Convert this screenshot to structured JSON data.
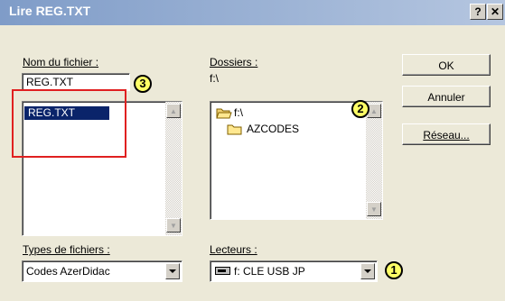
{
  "window": {
    "title": "Lire REG.TXT",
    "help_glyph": "?",
    "close_glyph": "✕"
  },
  "filename": {
    "label": "Nom du fichier :",
    "value": "REG.TXT",
    "files": [
      "REG.TXT"
    ]
  },
  "folders": {
    "label": "Dossiers :",
    "path": "f:\\",
    "items": [
      {
        "label": "f:\\",
        "icon": "open-folder-icon"
      },
      {
        "label": "AZCODES",
        "icon": "folder-icon"
      }
    ]
  },
  "filetypes": {
    "label": "Types de fichiers :",
    "value": "Codes AzerDidac"
  },
  "drives": {
    "label": "Lecteurs :",
    "value": "f: CLE USB JP",
    "icon": "usb-drive-icon"
  },
  "buttons": {
    "ok": "OK",
    "cancel": "Annuler",
    "network": "Réseau..."
  },
  "badges": [
    "1",
    "2",
    "3"
  ],
  "colors": {
    "titlebar": "#7f9cc8",
    "selection": "#0a246a",
    "annotation_box": "#e02020",
    "badge_fill": "#ffff66"
  }
}
